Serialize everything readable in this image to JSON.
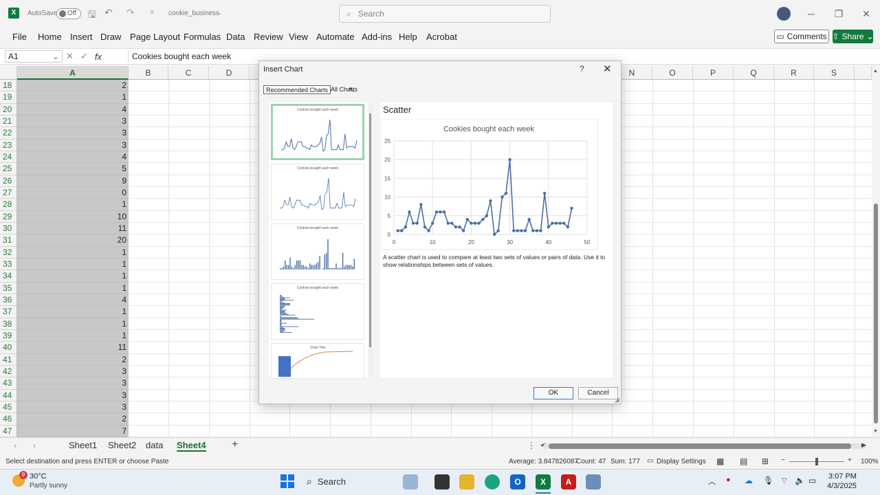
{
  "titlebar": {
    "autosave_label": "AutoSave",
    "autosave_state": "Off",
    "filename": "cookie_business",
    "search_placeholder": "Search"
  },
  "menu": {
    "items": [
      "File",
      "Home",
      "Insert",
      "Draw",
      "Page Layout",
      "Formulas",
      "Data",
      "Review",
      "View",
      "Automate",
      "Add-ins",
      "Help",
      "Acrobat"
    ],
    "comments_label": "Comments",
    "share_label": "Share"
  },
  "formula_bar": {
    "name_box": "A1",
    "fx": "fx",
    "formula": "Cookies bought each week"
  },
  "grid": {
    "columns": [
      "A",
      "B",
      "C",
      "D",
      "N",
      "O",
      "P",
      "Q",
      "R",
      "S"
    ],
    "rows": [
      {
        "n": "18",
        "v": "2"
      },
      {
        "n": "19",
        "v": "1"
      },
      {
        "n": "20",
        "v": "4"
      },
      {
        "n": "21",
        "v": "3"
      },
      {
        "n": "22",
        "v": "3"
      },
      {
        "n": "23",
        "v": "3"
      },
      {
        "n": "24",
        "v": "4"
      },
      {
        "n": "25",
        "v": "5"
      },
      {
        "n": "26",
        "v": "9"
      },
      {
        "n": "27",
        "v": "0"
      },
      {
        "n": "28",
        "v": "1"
      },
      {
        "n": "29",
        "v": "10"
      },
      {
        "n": "30",
        "v": "11"
      },
      {
        "n": "31",
        "v": "20"
      },
      {
        "n": "32",
        "v": "1"
      },
      {
        "n": "33",
        "v": "1"
      },
      {
        "n": "34",
        "v": "1"
      },
      {
        "n": "35",
        "v": "1"
      },
      {
        "n": "36",
        "v": "4"
      },
      {
        "n": "37",
        "v": "1"
      },
      {
        "n": "38",
        "v": "1"
      },
      {
        "n": "39",
        "v": "1"
      },
      {
        "n": "40",
        "v": "11"
      },
      {
        "n": "41",
        "v": "2"
      },
      {
        "n": "42",
        "v": "3"
      },
      {
        "n": "43",
        "v": "3"
      },
      {
        "n": "44",
        "v": "3"
      },
      {
        "n": "45",
        "v": "3"
      },
      {
        "n": "46",
        "v": "2"
      },
      {
        "n": "47",
        "v": "7"
      }
    ]
  },
  "sheets": {
    "tabs": [
      "Sheet1",
      "Sheet2",
      "data",
      "Sheet4"
    ],
    "active": "Sheet4",
    "add": "+"
  },
  "status": {
    "message": "Select destination and press ENTER or choose Paste",
    "average": "Average: 3.847826087",
    "count": "Count: 47",
    "sum": "Sum: 177",
    "display_settings": "Display Settings",
    "zoom": "100%"
  },
  "taskbar": {
    "weather_temp": "30°C",
    "weather_desc": "Partly sunny",
    "weather_badge": "9",
    "search": "Search",
    "time": "3:07 PM",
    "date": "4/3/2025"
  },
  "dialog": {
    "title": "Insert Chart",
    "help": "?",
    "close": "✕",
    "tab_recommended": "Recommended Charts",
    "tab_all": "All Charts",
    "preview_heading": "Scatter",
    "description": "A scatter chart is used to compare at least two sets of values or pairs of data. Use it to show relationships between sets of values.",
    "ok": "OK",
    "cancel": "Cancel",
    "thumb_titles": [
      "Cookies bought each week",
      "Cookies bought each week",
      "Cookies bought each week",
      "Cookies bought each week",
      "Chart Title"
    ]
  },
  "chart_data": {
    "type": "scatter",
    "title": "Cookies bought each week",
    "x": [
      1,
      2,
      3,
      4,
      5,
      6,
      7,
      8,
      9,
      10,
      11,
      12,
      13,
      14,
      15,
      16,
      17,
      18,
      19,
      20,
      21,
      22,
      23,
      24,
      25,
      26,
      27,
      28,
      29,
      30,
      31,
      32,
      33,
      34,
      35,
      36,
      37,
      38,
      39,
      40,
      41,
      42,
      43,
      44,
      45,
      46
    ],
    "y": [
      1,
      1,
      2,
      6,
      3,
      3,
      8,
      2,
      1,
      3,
      6,
      6,
      6,
      3,
      3,
      2,
      2,
      1,
      4,
      3,
      3,
      3,
      4,
      5,
      9,
      0,
      1,
      10,
      11,
      20,
      1,
      1,
      1,
      1,
      4,
      1,
      1,
      1,
      11,
      2,
      3,
      3,
      3,
      3,
      2,
      7
    ],
    "xlim": [
      0,
      50
    ],
    "ylim": [
      0,
      25
    ],
    "xticks": [
      0,
      10,
      20,
      30,
      40,
      50
    ],
    "yticks": [
      0,
      5,
      10,
      15,
      20,
      25
    ],
    "line_color": "#4a6fa5",
    "grid": true
  }
}
